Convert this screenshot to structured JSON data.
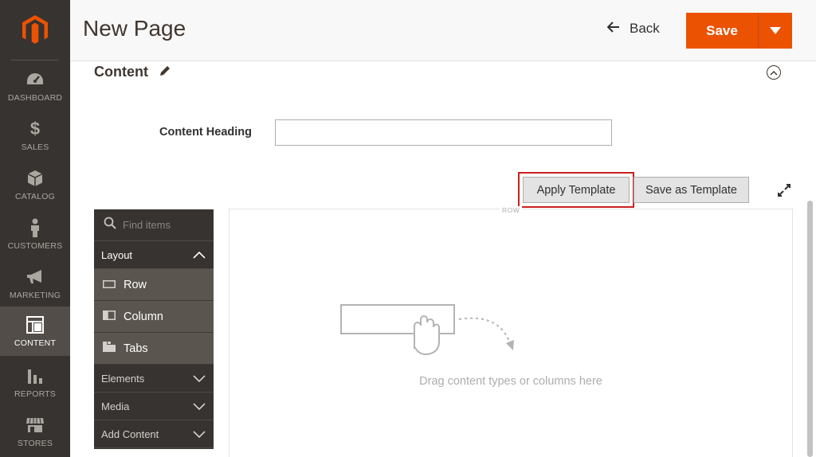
{
  "sidebar": {
    "items": [
      {
        "label": "DASHBOARD",
        "icon": "dashboard-icon"
      },
      {
        "label": "SALES",
        "icon": "dollar-icon"
      },
      {
        "label": "CATALOG",
        "icon": "box-icon"
      },
      {
        "label": "CUSTOMERS",
        "icon": "person-icon"
      },
      {
        "label": "MARKETING",
        "icon": "megaphone-icon"
      },
      {
        "label": "CONTENT",
        "icon": "layout-icon",
        "active": true
      },
      {
        "label": "REPORTS",
        "icon": "bar-chart-icon"
      },
      {
        "label": "STORES",
        "icon": "store-icon"
      }
    ]
  },
  "header": {
    "title": "New Page",
    "back_label": "Back",
    "save_label": "Save"
  },
  "content": {
    "section_title": "Content",
    "heading_label": "Content Heading",
    "heading_value": "",
    "apply_template_label": "Apply Template",
    "save_template_label": "Save as Template"
  },
  "pagebuilder": {
    "search_placeholder": "Find items",
    "groups": {
      "layout": "Layout",
      "elements": "Elements",
      "media": "Media",
      "add_content": "Add Content"
    },
    "layout_items": [
      {
        "label": "Row",
        "icon": "row-icon"
      },
      {
        "label": "Column",
        "icon": "column-icon"
      },
      {
        "label": "Tabs",
        "icon": "tabs-icon"
      }
    ],
    "stage_row_label": "ROW",
    "drop_text": "Drag content types or columns here"
  },
  "colors": {
    "accent": "#eb5202",
    "sidebar_bg": "#373330",
    "highlight_outline": "#cc1f1f"
  }
}
